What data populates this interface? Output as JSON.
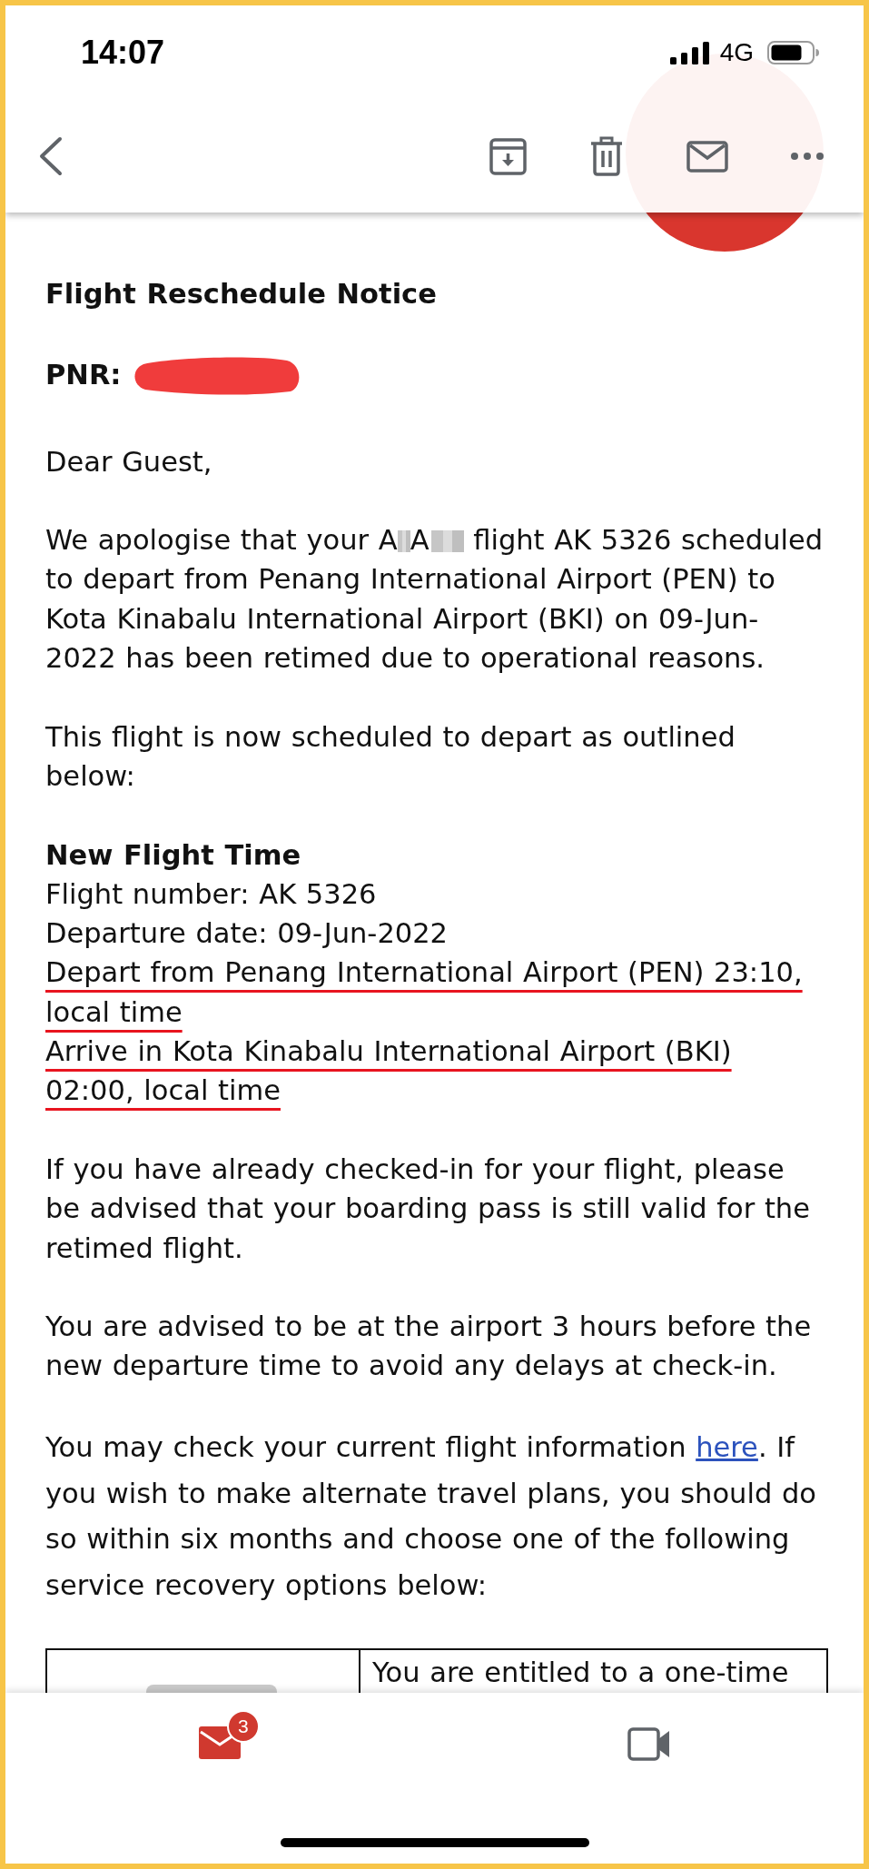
{
  "status_bar": {
    "time": "14:07",
    "network": "4G"
  },
  "message": [
    {
      "kind": "heading",
      "text": "Flight Reschedule Notice"
    },
    {
      "kind": "field",
      "label": "PNR:",
      "redacted": true
    },
    {
      "kind": "paragraph",
      "parts": [
        {
          "kind": "text",
          "text": "Dear Guest,"
        }
      ]
    },
    {
      "kind": "paragraph",
      "parts": [
        {
          "kind": "text",
          "text": "We apologise that your A"
        },
        {
          "kind": "redaction",
          "wide": false
        },
        {
          "kind": "text",
          "text": "A"
        },
        {
          "kind": "redaction",
          "wide": true
        },
        {
          "kind": "text",
          "text": " flight AK 5326 scheduled to depart from Penang International Airport (PEN) to Kota Kinabalu International Airport (BKI) on 09-Jun-2022 has been retimed due to operational reasons."
        }
      ]
    },
    {
      "kind": "paragraph",
      "parts": [
        {
          "kind": "text",
          "text": "This flight is now scheduled to depart as outlined below:"
        }
      ]
    },
    {
      "kind": "details",
      "heading": "New Flight Time",
      "lines": [
        {
          "text": "Flight number: AK 5326",
          "underlined": false
        },
        {
          "text": "Departure date: 09-Jun-2022",
          "underlined": false
        },
        {
          "text": "Depart from Penang International Airport (PEN) 23:10, local time",
          "underlined": true
        },
        {
          "text": "Arrive in Kota Kinabalu International Airport (BKI) 02:00, local time",
          "underlined": true
        }
      ]
    },
    {
      "kind": "paragraph",
      "parts": [
        {
          "kind": "text",
          "text": "If you have already checked-in for your flight, please be advised that your boarding pass is still valid for the retimed flight."
        }
      ]
    },
    {
      "kind": "paragraph",
      "parts": [
        {
          "kind": "text",
          "text": "You are advised to be at the airport 3 hours before the new departure time to avoid any delays at check-in."
        }
      ]
    },
    {
      "kind": "paragraph",
      "parts": [
        {
          "kind": "text",
          "text": "You may check your current flight information "
        },
        {
          "kind": "link",
          "text": "here"
        },
        {
          "kind": "text",
          "text": ". If you wish to make alternate travel plans, you should do so within six months and choose one of the following service recovery options below:"
        }
      ]
    },
    {
      "kind": "table",
      "rows": [
        {
          "cells": [
            {
              "kind": "image"
            },
            {
              "kind": "text",
              "text": "You are entitled to a one-time"
            }
          ]
        }
      ]
    }
  ],
  "tab_bar": [
    {
      "kind": "mail",
      "badge": "3",
      "selected": true
    },
    {
      "kind": "video",
      "selected": false
    }
  ]
}
